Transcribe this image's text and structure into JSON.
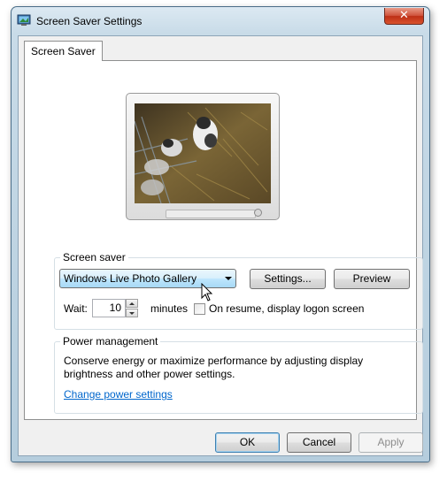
{
  "window": {
    "title": "Screen Saver Settings",
    "close_symbol": "✕"
  },
  "tabs": [
    {
      "label": "Screen Saver",
      "selected": true
    }
  ],
  "screen_saver": {
    "group_label": "Screen saver",
    "selected": "Windows Live Photo Gallery",
    "settings_button": "Settings...",
    "preview_button": "Preview",
    "wait_label": "Wait:",
    "wait_value": "10",
    "minutes_label": "minutes",
    "resume_checkbox_label": "On resume, display logon screen",
    "resume_checked": false
  },
  "power": {
    "group_label": "Power management",
    "description": "Conserve energy or maximize performance by adjusting display brightness and other power settings.",
    "link": "Change power settings"
  },
  "buttons": {
    "ok": "OK",
    "cancel": "Cancel",
    "apply": "Apply",
    "apply_enabled": false
  },
  "icons": {
    "app": "display-settings-icon",
    "close": "close-icon",
    "dropdown": "chevron-down-icon",
    "cursor": "mouse-pointer-icon"
  },
  "colors": {
    "link": "#0066cc",
    "close_button": "#c9432b",
    "default_button_border": "#3c7fb1"
  }
}
